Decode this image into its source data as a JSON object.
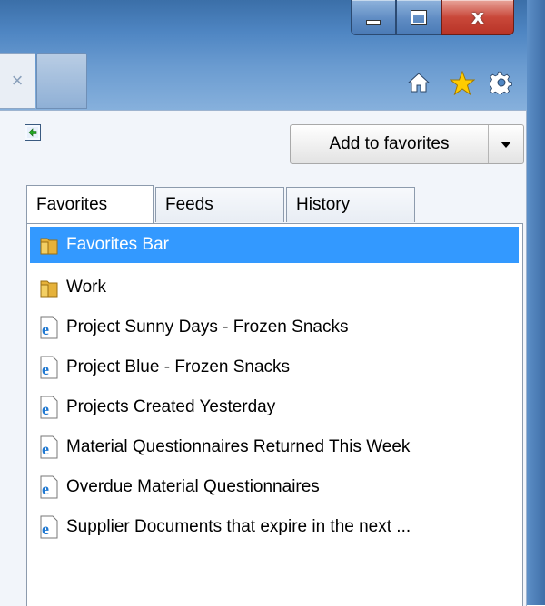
{
  "window": {
    "caption": {
      "minimize_symbol": "",
      "maximize_symbol": "",
      "close_symbol": "x"
    },
    "tab_close_symbol": "×"
  },
  "toolbar": {
    "icons": [
      "home-icon",
      "favorites-star-icon",
      "tools-gear-icon"
    ],
    "star_color": "#ffcc00"
  },
  "favorites_pane": {
    "add_to_favorites_label": "Add to favorites",
    "tabs": [
      {
        "label": "Favorites",
        "active": true
      },
      {
        "label": "Feeds",
        "active": false
      },
      {
        "label": "History",
        "active": false
      }
    ],
    "items": [
      {
        "label": "Favorites Bar",
        "icon": "folder-icon",
        "selected": true
      },
      {
        "label": "Work",
        "icon": "folder-icon",
        "selected": false
      },
      {
        "label": "Project Sunny Days - Frozen Snacks",
        "icon": "ie-page-icon",
        "selected": false
      },
      {
        "label": "Project Blue - Frozen Snacks",
        "icon": "ie-page-icon",
        "selected": false
      },
      {
        "label": "Projects Created Yesterday",
        "icon": "ie-page-icon",
        "selected": false
      },
      {
        "label": "Material Questionnaires Returned This Week",
        "icon": "ie-page-icon",
        "selected": false
      },
      {
        "label": "Overdue Material Questionnaires",
        "icon": "ie-page-icon",
        "selected": false
      },
      {
        "label": "Supplier Documents that expire in the next ...",
        "icon": "ie-page-icon",
        "selected": false
      }
    ],
    "selection_color": "#3399ff"
  }
}
